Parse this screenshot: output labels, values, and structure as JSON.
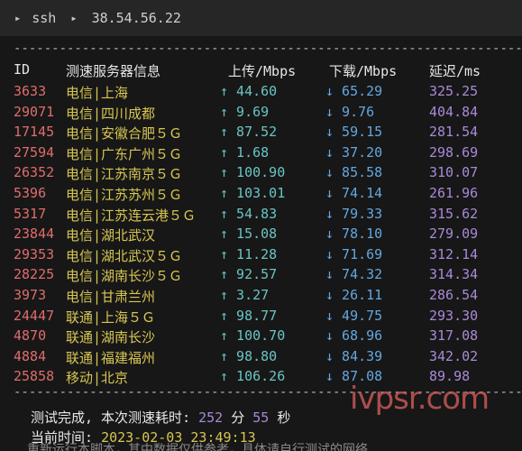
{
  "topbar": {
    "tab1": "ssh",
    "host": "38.54.56.22"
  },
  "dash_line": "------------------------------------------------------------------------------------------",
  "header": {
    "id": "ID",
    "server": "测速服务器信息",
    "upload": "上传/Mbps",
    "download": "下载/Mbps",
    "latency": "延迟/ms"
  },
  "rows": [
    {
      "id": "3633",
      "name": "电信|上海",
      "up": "↑ 44.60",
      "down": "↓ 65.29",
      "lat": "325.25"
    },
    {
      "id": "29071",
      "name": "电信|四川成都",
      "up": "↑ 9.69",
      "down": "↓ 9.76",
      "lat": "404.84"
    },
    {
      "id": "17145",
      "name": "电信|安徽合肥５Ｇ",
      "up": "↑ 87.52",
      "down": "↓ 59.15",
      "lat": "281.54"
    },
    {
      "id": "27594",
      "name": "电信|广东广州５Ｇ",
      "up": "↑ 1.68",
      "down": "↓ 37.20",
      "lat": "298.69"
    },
    {
      "id": "26352",
      "name": "电信|江苏南京５Ｇ",
      "up": "↑ 100.90",
      "down": "↓ 85.58",
      "lat": "310.07"
    },
    {
      "id": "5396",
      "name": "电信|江苏苏州５Ｇ",
      "up": "↑ 103.01",
      "down": "↓ 74.14",
      "lat": "261.96"
    },
    {
      "id": "5317",
      "name": "电信|江苏连云港５Ｇ",
      "up": "↑ 54.83",
      "down": "↓ 79.33",
      "lat": "315.62"
    },
    {
      "id": "23844",
      "name": "电信|湖北武汉",
      "up": "↑ 15.08",
      "down": "↓ 78.10",
      "lat": "279.09"
    },
    {
      "id": "29353",
      "name": "电信|湖北武汉５Ｇ",
      "up": "↑ 11.28",
      "down": "↓ 71.69",
      "lat": "312.14"
    },
    {
      "id": "28225",
      "name": "电信|湖南长沙５Ｇ",
      "up": "↑ 92.57",
      "down": "↓ 74.32",
      "lat": "314.34"
    },
    {
      "id": "3973",
      "name": "电信|甘肃兰州",
      "up": "↑ 3.27",
      "down": "↓ 26.11",
      "lat": "286.54"
    },
    {
      "id": "24447",
      "name": "联通|上海５Ｇ",
      "up": "↑ 98.77",
      "down": "↓ 49.75",
      "lat": "293.30"
    },
    {
      "id": "4870",
      "name": "联通|湖南长沙",
      "up": "↑ 100.70",
      "down": "↓ 68.96",
      "lat": "317.08"
    },
    {
      "id": "4884",
      "name": "联通|福建福州",
      "up": "↑ 98.80",
      "down": "↓ 84.39",
      "lat": "342.02"
    },
    {
      "id": "25858",
      "name": "移动|北京",
      "up": "↑ 106.26",
      "down": "↓ 87.08",
      "lat": "89.98"
    }
  ],
  "summary": {
    "done_prefix": "测试完成, 本次测速耗时: ",
    "minutes": "252",
    "min_unit": " 分 ",
    "seconds": "55",
    "sec_unit": " 秒",
    "time_label": "当前时间: ",
    "timestamp": "2023-02-03 23:49:13"
  },
  "watermark": "ivpsr.com",
  "cut_line": "重新运行本脚本，其中数据仅供参考，具体请自行测试的网络"
}
